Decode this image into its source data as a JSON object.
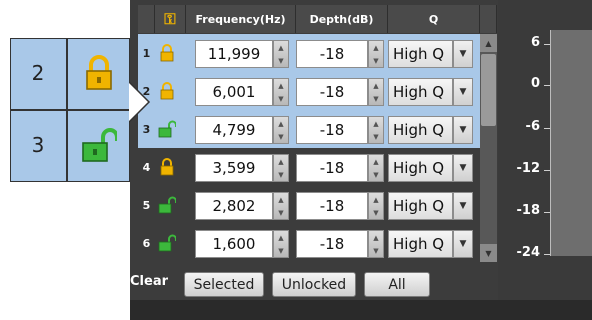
{
  "headers": {
    "lock_col": "lock-key-icon",
    "frequency": "Frequency(Hz)",
    "depth": "Depth(dB)",
    "q": "Q"
  },
  "rows": [
    {
      "num": "1",
      "lock": "locked",
      "frequency": "11,999",
      "depth": "-18",
      "q": "High Q"
    },
    {
      "num": "2",
      "lock": "locked",
      "frequency": "6,001",
      "depth": "-18",
      "q": "High Q"
    },
    {
      "num": "3",
      "lock": "unlocked",
      "frequency": "4,799",
      "depth": "-18",
      "q": "High Q"
    },
    {
      "num": "4",
      "lock": "locked",
      "frequency": "3,599",
      "depth": "-18",
      "q": "High Q"
    },
    {
      "num": "5",
      "lock": "unlocked",
      "frequency": "2,802",
      "depth": "-18",
      "q": "High Q"
    },
    {
      "num": "6",
      "lock": "unlocked",
      "frequency": "1,600",
      "depth": "-18",
      "q": "High Q"
    }
  ],
  "clear": {
    "label": "Clear",
    "selected": "Selected",
    "unlocked": "Unlocked",
    "all": "All"
  },
  "graph": {
    "ticks": [
      "6",
      "0",
      "-6",
      "-12",
      "-18",
      "-24"
    ]
  },
  "zoom": {
    "row_a_num": "2",
    "row_a_lock": "locked",
    "row_b_num": "3",
    "row_b_lock": "unlocked"
  },
  "colors": {
    "locked": "#f0b400",
    "unlocked": "#3cb83c",
    "selection": "#a9c8e8",
    "panel": "#3c3c3c"
  }
}
